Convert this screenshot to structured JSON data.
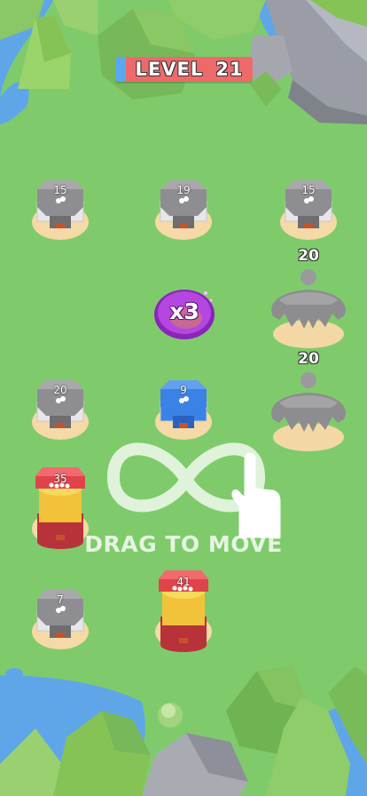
{
  "hud": {
    "level_label": "LEVEL",
    "level_number": "21",
    "level_progress_fraction": 0.08
  },
  "towers": [
    {
      "count": "15",
      "team": "neutral"
    },
    {
      "count": "19",
      "team": "neutral"
    },
    {
      "count": "15",
      "team": "neutral"
    },
    {
      "count": "20",
      "team": "neutral"
    },
    {
      "count": "9",
      "team": "player"
    },
    {
      "count": "35",
      "team": "enemy"
    },
    {
      "count": "7",
      "team": "neutral"
    },
    {
      "count": "41",
      "team": "enemy"
    }
  ],
  "bosses": [
    {
      "count": "20"
    },
    {
      "count": "20"
    }
  ],
  "powerup": {
    "label": "x3"
  },
  "tutorial": {
    "instruction": "DRAG TO MOVE",
    "icon": "hand-pointer-icon"
  },
  "colors": {
    "grass": "#7fcb6c",
    "neutral": "#8e8e90",
    "player": "#3b82e6",
    "enemy": "#e0444a",
    "pad": "#f5d9a6",
    "banner": "#ee6a6a",
    "progress": "#5aa8ee",
    "powerup": "#9b2fc9"
  }
}
